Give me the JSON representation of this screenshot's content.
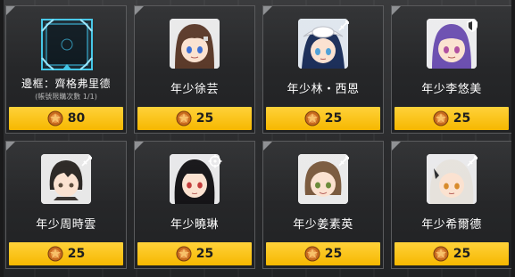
{
  "shop": {
    "items": [
      {
        "name": "邊框：齊格弗里德",
        "note": "(帳號限購次數 1/1)",
        "price": "80",
        "kind": "frame",
        "badge": "none"
      },
      {
        "name": "年少徐芸",
        "price": "25",
        "kind": "chibi",
        "badge": "none",
        "hair": "#5b3a2a",
        "eyes": "#3d6fd6"
      },
      {
        "name": "年少林・西恩",
        "price": "25",
        "kind": "chibi",
        "badge": "swords-icon",
        "hair": "#1c2f5a",
        "eyes": "#4fa1d8"
      },
      {
        "name": "年少李悠美",
        "price": "25",
        "kind": "chibi",
        "badge": "shield-icon",
        "hair": "#6c4fb0",
        "eyes": "#b04fa0"
      },
      {
        "name": "年少周時雲",
        "price": "25",
        "kind": "chibi",
        "badge": "swords-icon",
        "hair": "#2a2623",
        "eyes": "#5a4a3a"
      },
      {
        "name": "年少曉琳",
        "price": "25",
        "kind": "chibi",
        "badge": "crosshair-icon",
        "hair": "#151417",
        "eyes": "#c23a3a"
      },
      {
        "name": "年少姜素英",
        "price": "25",
        "kind": "chibi",
        "badge": "swords-icon",
        "hair": "#7a5a3e",
        "eyes": "#6b8a3a"
      },
      {
        "name": "年少希爾德",
        "price": "25",
        "kind": "chibi",
        "badge": "swords-icon",
        "hair": "#e6e2dc",
        "eyes": "#d88a2a"
      }
    ],
    "colors": {
      "price_bar": "#f6b800",
      "card_border": "#5a5b5d"
    }
  }
}
